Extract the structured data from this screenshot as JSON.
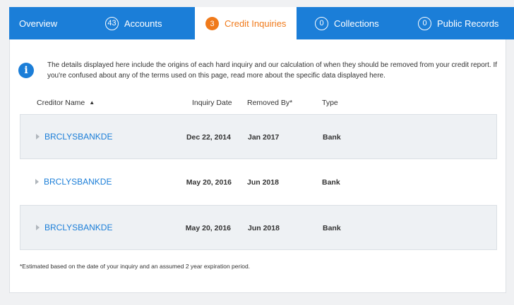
{
  "tabs": [
    {
      "label": "Overview",
      "badge": "",
      "active": false
    },
    {
      "label": "Accounts",
      "badge": "43",
      "active": false
    },
    {
      "label": "Credit Inquiries",
      "badge": "3",
      "active": true
    },
    {
      "label": "Collections",
      "badge": "0",
      "active": false
    },
    {
      "label": "Public Records",
      "badge": "0",
      "active": false
    }
  ],
  "info": {
    "text": "The details displayed here include the origins of each hard inquiry and our calculation of when they should be removed from your credit report. If you're confused about any of the terms used on this page, read more about the specific data displayed here."
  },
  "table": {
    "headers": {
      "creditor": "Creditor Name",
      "date": "Inquiry Date",
      "removed": "Removed By*",
      "type": "Type"
    },
    "rows": [
      {
        "creditor": "BRCLYSBANKDE",
        "date": "Dec 22, 2014",
        "removed": "Jan 2017",
        "type": "Bank"
      },
      {
        "creditor": "BRCLYSBANKDE",
        "date": "May 20, 2016",
        "removed": "Jun 2018",
        "type": "Bank"
      },
      {
        "creditor": "BRCLYSBANKDE",
        "date": "May 20, 2016",
        "removed": "Jun 2018",
        "type": "Bank"
      }
    ]
  },
  "footnote": "*Estimated based on the date of your inquiry and an assumed 2 year expiration period.",
  "colors": {
    "accent": "#1b7ed8",
    "active_tab_text": "#f07a1b"
  }
}
